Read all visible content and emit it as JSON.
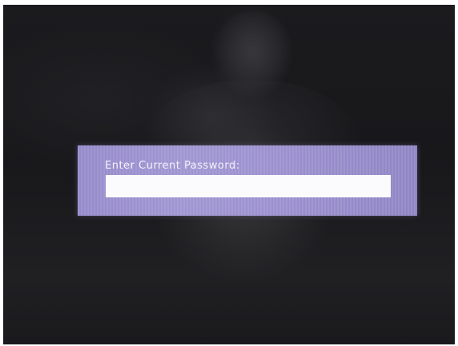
{
  "dialog": {
    "label": "Enter Current Password:",
    "password_value": ""
  },
  "colors": {
    "dialog_background": "#a097d3",
    "dialog_text": "#f4f2fb",
    "field_background": "#fbfbfd",
    "screen_background": "#1b1b1e"
  }
}
